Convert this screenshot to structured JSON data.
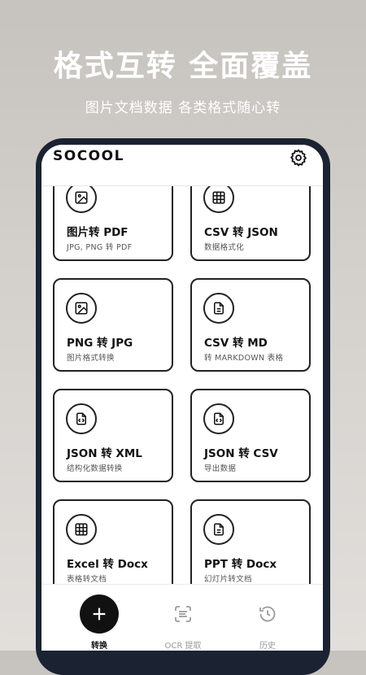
{
  "promo": {
    "title": "格式互转 全面覆盖",
    "subtitle": "图片文档数据 各类格式随心转"
  },
  "app": {
    "logo": "SOCOOL",
    "settings_icon": "gear-icon"
  },
  "cards": [
    {
      "title": "图片转 PDF",
      "subtitle": "JPG, PNG 转 PDF",
      "icon": "image-icon"
    },
    {
      "title": "CSV 转 JSON",
      "subtitle": "数据格式化",
      "icon": "table-icon"
    },
    {
      "title": "PNG 转 JPG",
      "subtitle": "图片格式转换",
      "icon": "image-icon"
    },
    {
      "title": "CSV 转 MD",
      "subtitle": "转 MARKDOWN 表格",
      "icon": "document-icon"
    },
    {
      "title": "JSON 转 XML",
      "subtitle": "结构化数据转换",
      "icon": "code-file-icon"
    },
    {
      "title": "JSON 转 CSV",
      "subtitle": "导出数据",
      "icon": "code-file-icon"
    },
    {
      "title": "Excel 转 Docx",
      "subtitle": "表格转文档",
      "icon": "table-icon"
    },
    {
      "title": "PPT 转 Docx",
      "subtitle": "幻灯片转文档",
      "icon": "document-icon"
    }
  ],
  "tabs": [
    {
      "label": "转换",
      "icon": "plus-icon",
      "active": true
    },
    {
      "label": "OCR 提取",
      "icon": "scan-text-icon",
      "active": false
    },
    {
      "label": "历史",
      "icon": "history-icon",
      "active": false
    }
  ],
  "colors": {
    "phone_frame": "#1b2333",
    "active_text": "#111111",
    "inactive_text": "#9a9a9a"
  }
}
